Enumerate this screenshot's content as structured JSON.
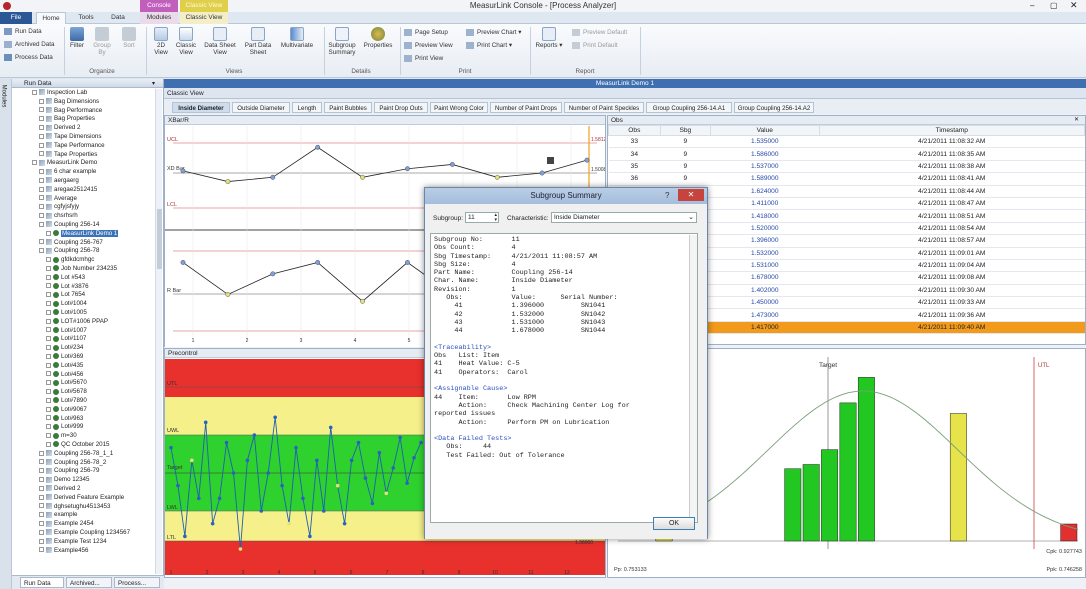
{
  "app": {
    "title": "MeasurLink Console - [Process Analyzer]"
  },
  "ribbon_context": {
    "console": "Console",
    "classic": "Classic View"
  },
  "tabs": [
    "File",
    "Home",
    "Tools",
    "Data",
    "Modules",
    "Classic View"
  ],
  "ribbon": {
    "rundata": [
      "Run Data",
      "Archived Data",
      "Process Data"
    ],
    "organize": [
      "Filter",
      "Group By",
      "Sort"
    ],
    "views": [
      "2D View",
      "Classic View",
      "Data Sheet View",
      "Part Data Sheet",
      "Multivariate"
    ],
    "details": [
      "Subgroup Summary",
      "Properties"
    ],
    "print": [
      "Page Setup",
      "Preview View",
      "Print View",
      "Preview Chart",
      "Print Chart"
    ],
    "reports": "Reports",
    "report": [
      "Preview Default",
      "Print Default"
    ],
    "groups": [
      "Organize",
      "Views",
      "Details",
      "Print",
      "Report"
    ]
  },
  "sidebar": {
    "modules_label": "Modules",
    "header": "Run Data",
    "tree": [
      "Inspection Lab",
      "Bag Dimensions",
      "Bag Performance",
      "Bag Properties",
      "Derived 2",
      "Tape Dimensions",
      "Tape Performance",
      "Tape Properties",
      "MeasurLink Demo",
      "6 char example",
      "aergaerg",
      "aregae2512415",
      "Average",
      "cgfyjsfyjy",
      "chsrhsrh",
      "Coupling 256-14",
      "MeasurLink Demo 1",
      "Coupling 256-767",
      "Coupling 256-78",
      "gfdkdcmhgc",
      "Job Number 234235",
      "Lot #543",
      "Lot #3876",
      "Lot 7654",
      "Lot#1004",
      "Lot#1005",
      "LOT#1006 PPAP",
      "Lot#1007",
      "Lot#1107",
      "Lot#234",
      "Lot#369",
      "Lot#435",
      "Lot#456",
      "Lot#5670",
      "Lot#5678",
      "Lot#7890",
      "Lot#9067",
      "Lot#963",
      "Lot#999",
      "m=30",
      "QC October 2015",
      "Coupling 256-78_1_1",
      "Coupling 256-78_2",
      "Coupling 256-79",
      "Demo 12345",
      "Derived 2",
      "Derived Feature Example",
      "dghsetughu4513453",
      "example",
      "Example 2454",
      "Example Coupling 1234567",
      "Example Test 1234",
      "Example456"
    ],
    "bottom_tabs": [
      "Run Data",
      "Archived...",
      "Process..."
    ]
  },
  "doc": {
    "title": "MeasurLink Demo 1",
    "view_label": "Classic View",
    "chart_tabs": [
      "Inside Diameter",
      "Outside Diameter",
      "Length",
      "Paint Bubbles",
      "Paint Drop Outs",
      "Paint Wrong Color",
      "Number of Paint Drops",
      "Number of Paint Speckles",
      "Group Coupling 256-14.A1",
      "Group Coupling 256-14.A2"
    ]
  },
  "xbar": {
    "panel": "XBar/R",
    "lbl_ucl": "UCL",
    "lbl_xbar": "XD Bar",
    "lbl_lcl": "LCL",
    "lbl_rbar": "R Bar",
    "lbl_right1": "1.58126",
    "lbl_right2": "1.50087",
    "xticks": [
      "1",
      "2",
      "3",
      "4",
      "5",
      "6",
      "7"
    ],
    "chart_data": {
      "type": "line",
      "series": [
        {
          "values": [
            1.505,
            1.48,
            1.49,
            1.56,
            1.49,
            1.51,
            1.52,
            1.49,
            1.5,
            1.53
          ]
        },
        {
          "values": [
            0.3,
            0.16,
            0.25,
            0.3,
            0.13,
            0.3,
            0.16,
            0.28,
            0.12,
            0.3
          ]
        }
      ]
    }
  },
  "precontrol": {
    "panel": "Precontrol",
    "labels": [
      "UTL",
      "UWL",
      "Target",
      "LWL",
      "LTL"
    ],
    "right": "1.36000",
    "xticks": [
      "1",
      "2",
      "3",
      "4",
      "5",
      "6",
      "7",
      "8",
      "9",
      "10",
      "11",
      "12"
    ],
    "chart_data": {
      "type": "line",
      "values": [
        1.6,
        1.45,
        1.25,
        1.55,
        1.4,
        1.7,
        1.3,
        1.4,
        1.62,
        1.5,
        1.2,
        1.55,
        1.65,
        1.35,
        1.5,
        1.72,
        1.45,
        1.3,
        1.6,
        1.4,
        1.25,
        1.55,
        1.35,
        1.68,
        1.45,
        1.3,
        1.55,
        1.62,
        1.48,
        1.38,
        1.58,
        1.42,
        1.52,
        1.64,
        1.46,
        1.56,
        1.62
      ]
    }
  },
  "obs": {
    "panel": "Obs",
    "columns": [
      "Obs",
      "Sbg",
      "Value",
      "Timestamp"
    ],
    "rows": [
      [
        "33",
        "9",
        "1.535000",
        "4/21/2011 11:08:32 AM"
      ],
      [
        "34",
        "9",
        "1.586000",
        "4/21/2011 11:08:35 AM"
      ],
      [
        "35",
        "9",
        "1.537000",
        "4/21/2011 11:08:38 AM"
      ],
      [
        "36",
        "9",
        "1.589000",
        "4/21/2011 11:08:41 AM"
      ],
      [
        "37",
        "10",
        "1.624000",
        "4/21/2011 11:08:44 AM"
      ],
      [
        "38",
        "10",
        "1.411000",
        "4/21/2011 11:08:47 AM"
      ],
      [
        "39",
        "10",
        "1.418000",
        "4/21/2011 11:08:51 AM"
      ],
      [
        "40",
        "10",
        "1.520000",
        "4/21/2011 11:08:54 AM"
      ],
      [
        "41",
        "11",
        "1.396000",
        "4/21/2011 11:08:57 AM"
      ],
      [
        "42",
        "11",
        "1.532000",
        "4/21/2011 11:09:01 AM"
      ],
      [
        "43",
        "11",
        "1.531000",
        "4/21/2011 11:09:04 AM"
      ],
      [
        "44",
        "11",
        "1.678000",
        "4/21/2011 11:09:08 AM"
      ],
      [
        "45",
        "12",
        "1.402000",
        "4/21/2011 11:09:30 AM"
      ],
      [
        "46",
        "12",
        "1.450000",
        "4/21/2011 11:09:33 AM"
      ],
      [
        "47",
        "12",
        "1.473000",
        "4/21/2011 11:09:36 AM"
      ],
      [
        "48",
        "12",
        "1.417000",
        "4/21/2011 11:09:40 AM"
      ]
    ],
    "highlight_row": 15
  },
  "hist": {
    "target": "Target",
    "utl": "UTL",
    "cpk": "Cpk: 0.927743",
    "ppk": "Ppk: 0.746258",
    "pp": "Pp: 0.753133",
    "chart_data": {
      "type": "bar",
      "values": [
        0,
        0,
        58,
        0,
        0,
        0,
        0,
        0,
        0,
        34,
        36,
        43,
        65,
        77,
        0,
        0,
        0,
        0,
        60,
        0,
        0,
        0,
        0,
        0,
        8
      ]
    }
  },
  "dialog": {
    "title": "Subgroup Summary",
    "subgroup_label": "Subgroup:",
    "subgroup_value": "11",
    "characteristic_label": "Characteristic:",
    "characteristic_value": "Inside Diameter",
    "ok": "OK",
    "lines": [
      "Subgroup No:       11",
      "Obs Count:         4",
      "Sbg Timestamp:     4/21/2011 11:08:57 AM",
      "Sbg Size:          4",
      "Part Name:         Coupling 256-14",
      "Char. Name:        Inside Diameter",
      "Revision:          1",
      "   Obs:            Value:      Serial Number:",
      "     41            1.396000         SN1041",
      "     42            1.532000         SN1042",
      "     43            1.531000         SN1043",
      "     44            1.678000         SN1044",
      "",
      "<Traceability>",
      "Obs   List: Item",
      "41    Heat Value: C-5",
      "41    Operators:  Carol",
      "",
      "<Assignable Cause>",
      "44    Item:       Low RPM",
      "      Action:     Check Machining Center Log for",
      "reported issues",
      "      Action:     Perform PM on Lubrication",
      "",
      "<Data Failed Tests>",
      "   Obs:     44",
      "   Test Failed: Out of Tolerance"
    ]
  }
}
